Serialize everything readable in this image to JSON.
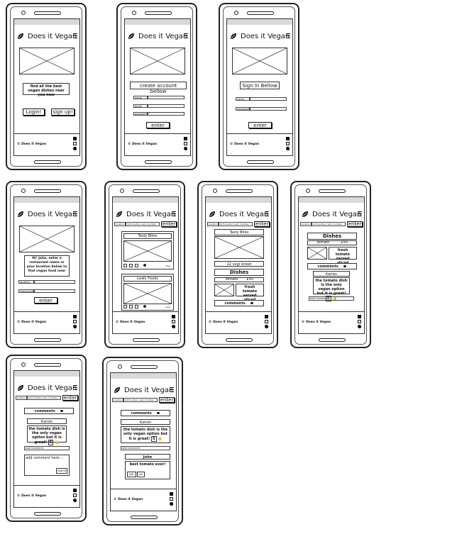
{
  "app": {
    "name": "Does it Vegan",
    "copyright": "©  Does it Vegan"
  },
  "social_icons": [
    "facebook-icon",
    "instagram-icon",
    "twitter-icon"
  ],
  "screens": {
    "home": {
      "tagline": "find all the best vegan dishes near you now",
      "login": "Login!",
      "signup": "sign up!"
    },
    "create": {
      "title": "create account bellow",
      "fields": [
        "name",
        "email",
        "password"
      ],
      "enter": "enter"
    },
    "signin": {
      "title": "Sign In Bellow",
      "fields": [
        "name",
        "password"
      ],
      "enter": "enter"
    },
    "welcome": {
      "message": "Hi! John, enter a restaurant name or your location below to find vegan food near",
      "fields": [
        "location",
        "restaurants"
      ],
      "enter": "enter"
    },
    "search": {
      "location_label": "location",
      "location_value": "123 location road, mumbai",
      "enter": "enter"
    },
    "results": {
      "cards": [
        {
          "name": "Tasty Bites",
          "more": "view"
        },
        {
          "name": "Leafy Foods",
          "more": "view"
        }
      ]
    },
    "restaurant": {
      "name": "Tasty Bites",
      "address": "12 vegi street",
      "dishes_label": "Dishes",
      "dish": {
        "name": "Tomato",
        "price": "£50",
        "desc": "fresh tomato served sliced"
      },
      "comments_label": "comments"
    },
    "dish_comments": {
      "dishes_label": "Dishes",
      "dish": {
        "name": "Tomato",
        "price": "£50",
        "desc": "fresh tomato served sliced"
      },
      "comments_label": "comments",
      "author": "Karren",
      "comment": "the tomato dish is the only vegan option but it is great!",
      "likes": "5",
      "add_placeholder": "Add Comment"
    },
    "add_comment": {
      "comments_label": "comments",
      "author": "Karren",
      "comment": "the tomato dish is the only vegan option but it is great!",
      "likes": "5",
      "add_placeholder": "Add Comment",
      "draft": "add comment here ...",
      "submit": "Submit"
    },
    "edit_comment": {
      "comments_label": "comments",
      "author": "Karren",
      "comment": "the tomato dish is the only vegan option but it is great!",
      "likes": "5",
      "add_placeholder": "Add Comment",
      "author2": "John",
      "comment2": "best tomato ever!",
      "edit": "edit",
      "delete": "del"
    }
  }
}
